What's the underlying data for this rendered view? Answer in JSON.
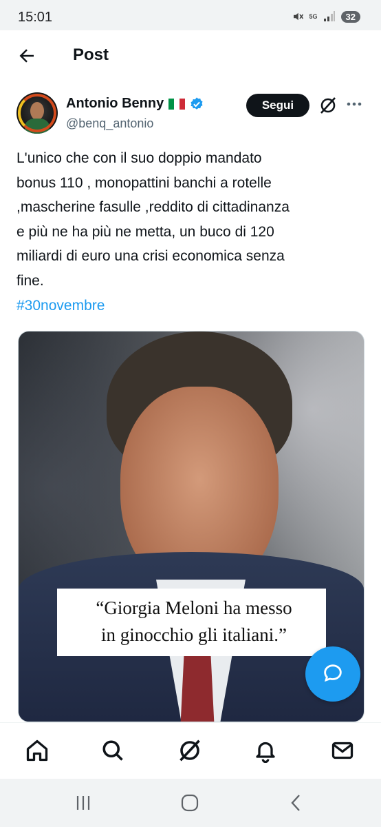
{
  "status_bar": {
    "time": "15:01",
    "network": "5G",
    "battery": "32"
  },
  "header": {
    "title": "Post"
  },
  "author": {
    "name": "Antonio Benny",
    "handle": "@benq_antonio"
  },
  "actions": {
    "follow_label": "Segui"
  },
  "tweet": {
    "text": "L'unico che con il suo doppio mandato\nbonus 110 , monopattini  banchi a rotelle\n,mascherine fasulle ,reddito di cittadinanza\ne più ne ha più ne metta,  un buco di 120\nmiliardi di euro una crisi economica senza\nfine.",
    "hashtag": "#30novembre"
  },
  "media": {
    "quote_line1": "“Giorgia Meloni ha messo",
    "quote_line2": "in ginocchio gli italiani.”"
  },
  "colors": {
    "accent": "#1d9bf0",
    "text": "#0f1419",
    "secondary": "#536471"
  },
  "tab_bar": [
    "home-icon",
    "search-icon",
    "grok-icon",
    "notifications-icon",
    "messages-icon"
  ],
  "system_nav": [
    "recent-apps-icon",
    "home-circle-icon",
    "back-icon"
  ]
}
